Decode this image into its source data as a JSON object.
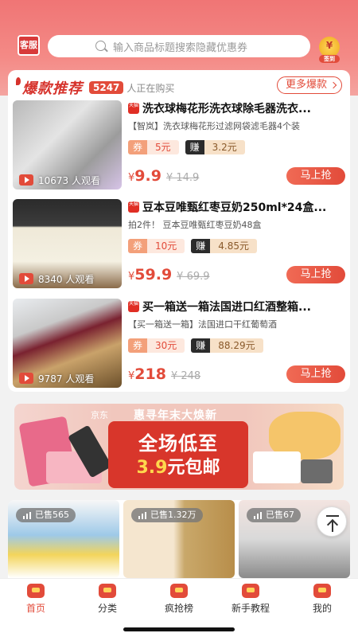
{
  "header": {
    "service_label": "客服",
    "search_placeholder": "输入商品标题搜索隐藏优惠券",
    "signin_symbol": "¥",
    "signin_label": "签到"
  },
  "hot": {
    "title": "爆款推荐",
    "count": "5247",
    "subtitle": "人正在购买",
    "more_label": "更多爆款"
  },
  "products": [
    {
      "platform": "天猫",
      "title": "洗衣球梅花形洗衣球除毛器洗衣...",
      "desc": "【智岚】洗衣球梅花形过滤网袋滤毛器4个装",
      "coupon_key": "券",
      "coupon_value": "5元",
      "earn_key": "赚",
      "earn_value": "3.2元",
      "currency": "¥",
      "price": "9.9",
      "original_price": "¥ 14.9",
      "watchers": "10673 人观看",
      "buy_label": "马上抢"
    },
    {
      "platform": "天猫",
      "title": "豆本豆唯甄红枣豆奶250ml*24盒...",
      "desc": "拍2件！ 豆本豆唯甄红枣豆奶48盒",
      "coupon_key": "券",
      "coupon_value": "10元",
      "earn_key": "赚",
      "earn_value": "4.85元",
      "currency": "¥",
      "price": "59.9",
      "original_price": "¥ 69.9",
      "watchers": "8340 人观看",
      "buy_label": "马上抢"
    },
    {
      "platform": "天猫",
      "title": "买一箱送一箱法国进口红酒整箱...",
      "desc": "【买一箱送一箱】法国进口干红葡萄酒",
      "coupon_key": "券",
      "coupon_value": "30元",
      "earn_key": "赚",
      "earn_value": "88.29元",
      "currency": "¥",
      "price": "218",
      "original_price": "¥ 248",
      "watchers": "9787 人观看",
      "buy_label": "马上抢"
    }
  ],
  "banner": {
    "store": "京东",
    "slogan": "惠寻年末大焕新",
    "line1": "全场低至",
    "line2_price": "3.9",
    "line2_rest": "元包邮"
  },
  "grid": [
    {
      "sold": "已售565"
    },
    {
      "sold": "已售1.32万"
    },
    {
      "sold": "已售67"
    }
  ],
  "tabs": [
    {
      "label": "首页"
    },
    {
      "label": "分类"
    },
    {
      "label": "疯抢榜"
    },
    {
      "label": "新手教程"
    },
    {
      "label": "我的"
    }
  ],
  "colors": {
    "accent": "#e24b3a",
    "header_top": "#f07575"
  }
}
